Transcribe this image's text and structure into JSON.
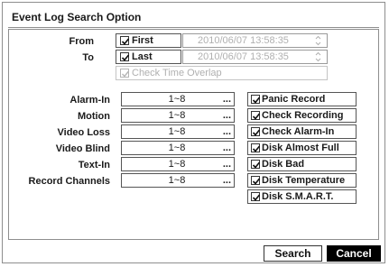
{
  "dialog": {
    "title": "Event Log Search Option"
  },
  "time": {
    "from_label": "From",
    "to_label": "To",
    "first": {
      "label": "First",
      "checked": true,
      "datetime": "2010/06/07  13:58:35"
    },
    "last": {
      "label": "Last",
      "checked": true,
      "datetime": "2010/06/07  13:58:35"
    },
    "overlap": {
      "label": "Check Time Overlap",
      "checked": true,
      "enabled": false
    }
  },
  "filters": [
    {
      "label": "Alarm-In",
      "value": "1~8"
    },
    {
      "label": "Motion",
      "value": "1~8"
    },
    {
      "label": "Video Loss",
      "value": "1~8"
    },
    {
      "label": "Video Blind",
      "value": "1~8"
    },
    {
      "label": "Text-In",
      "value": "1~8"
    },
    {
      "label": "Record Channels",
      "value": "1~8"
    }
  ],
  "ellipsis": "...",
  "system_events": [
    {
      "label": "Panic Record",
      "checked": true
    },
    {
      "label": "Check Recording",
      "checked": true
    },
    {
      "label": "Check Alarm-In",
      "checked": true
    },
    {
      "label": "Disk Almost Full",
      "checked": true
    },
    {
      "label": "Disk Bad",
      "checked": true
    },
    {
      "label": "Disk Temperature",
      "checked": true
    },
    {
      "label": "Disk S.M.A.R.T.",
      "checked": true
    }
  ],
  "buttons": {
    "search": "Search",
    "cancel": "Cancel"
  }
}
